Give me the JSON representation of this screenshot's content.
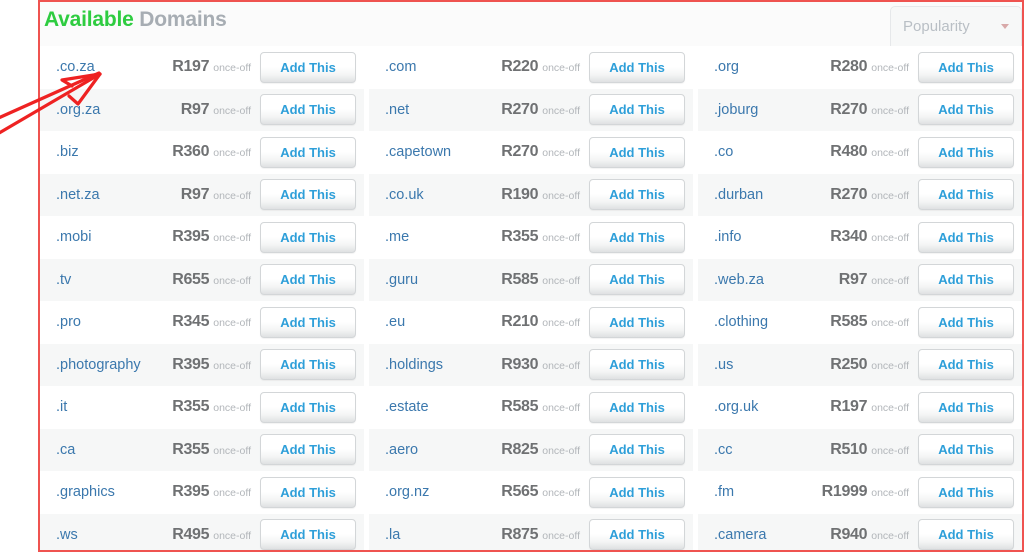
{
  "panel": {
    "title_accent": "Available",
    "title_rest": " Domains",
    "accent_color": "#2ecc40",
    "title_rest_color": "#a7adb3",
    "highlight_border_color": "#ef5350"
  },
  "sort": {
    "label": "Popularity",
    "caret_icon": "chevron-down-icon"
  },
  "annotation": {
    "type": "arrow",
    "color": "#ee2222",
    "points_to": ".co.za"
  },
  "row_defaults": {
    "period": "once-off",
    "add_label": "Add This"
  },
  "columns": [
    {
      "name": "column-1",
      "rows": [
        {
          "tld": ".co.za",
          "price": "R197",
          "period": "once-off",
          "add_label": "Add This"
        },
        {
          "tld": ".org.za",
          "price": "R97",
          "period": "once-off",
          "add_label": "Add This"
        },
        {
          "tld": ".biz",
          "price": "R360",
          "period": "once-off",
          "add_label": "Add This"
        },
        {
          "tld": ".net.za",
          "price": "R97",
          "period": "once-off",
          "add_label": "Add This"
        },
        {
          "tld": ".mobi",
          "price": "R395",
          "period": "once-off",
          "add_label": "Add This"
        },
        {
          "tld": ".tv",
          "price": "R655",
          "period": "once-off",
          "add_label": "Add This"
        },
        {
          "tld": ".pro",
          "price": "R345",
          "period": "once-off",
          "add_label": "Add This"
        },
        {
          "tld": ".photography",
          "price": "R395",
          "period": "once-off",
          "add_label": "Add This"
        },
        {
          "tld": ".it",
          "price": "R355",
          "period": "once-off",
          "add_label": "Add This"
        },
        {
          "tld": ".ca",
          "price": "R355",
          "period": "once-off",
          "add_label": "Add This"
        },
        {
          "tld": ".graphics",
          "price": "R395",
          "period": "once-off",
          "add_label": "Add This"
        },
        {
          "tld": ".ws",
          "price": "R495",
          "period": "once-off",
          "add_label": "Add This"
        }
      ]
    },
    {
      "name": "column-2",
      "rows": [
        {
          "tld": ".com",
          "price": "R220",
          "period": "once-off",
          "add_label": "Add This"
        },
        {
          "tld": ".net",
          "price": "R270",
          "period": "once-off",
          "add_label": "Add This"
        },
        {
          "tld": ".capetown",
          "price": "R270",
          "period": "once-off",
          "add_label": "Add This"
        },
        {
          "tld": ".co.uk",
          "price": "R190",
          "period": "once-off",
          "add_label": "Add This"
        },
        {
          "tld": ".me",
          "price": "R355",
          "period": "once-off",
          "add_label": "Add This"
        },
        {
          "tld": ".guru",
          "price": "R585",
          "period": "once-off",
          "add_label": "Add This"
        },
        {
          "tld": ".eu",
          "price": "R210",
          "period": "once-off",
          "add_label": "Add This"
        },
        {
          "tld": ".holdings",
          "price": "R930",
          "period": "once-off",
          "add_label": "Add This"
        },
        {
          "tld": ".estate",
          "price": "R585",
          "period": "once-off",
          "add_label": "Add This"
        },
        {
          "tld": ".aero",
          "price": "R825",
          "period": "once-off",
          "add_label": "Add This"
        },
        {
          "tld": ".org.nz",
          "price": "R565",
          "period": "once-off",
          "add_label": "Add This"
        },
        {
          "tld": ".la",
          "price": "R875",
          "period": "once-off",
          "add_label": "Add This"
        }
      ]
    },
    {
      "name": "column-3",
      "rows": [
        {
          "tld": ".org",
          "price": "R280",
          "period": "once-off",
          "add_label": "Add This"
        },
        {
          "tld": ".joburg",
          "price": "R270",
          "period": "once-off",
          "add_label": "Add This"
        },
        {
          "tld": ".co",
          "price": "R480",
          "period": "once-off",
          "add_label": "Add This"
        },
        {
          "tld": ".durban",
          "price": "R270",
          "period": "once-off",
          "add_label": "Add This"
        },
        {
          "tld": ".info",
          "price": "R340",
          "period": "once-off",
          "add_label": "Add This"
        },
        {
          "tld": ".web.za",
          "price": "R97",
          "period": "once-off",
          "add_label": "Add This"
        },
        {
          "tld": ".clothing",
          "price": "R585",
          "period": "once-off",
          "add_label": "Add This"
        },
        {
          "tld": ".us",
          "price": "R250",
          "period": "once-off",
          "add_label": "Add This"
        },
        {
          "tld": ".org.uk",
          "price": "R197",
          "period": "once-off",
          "add_label": "Add This"
        },
        {
          "tld": ".cc",
          "price": "R510",
          "period": "once-off",
          "add_label": "Add This"
        },
        {
          "tld": ".fm",
          "price": "R1999",
          "period": "once-off",
          "add_label": "Add This"
        },
        {
          "tld": ".camera",
          "price": "R940",
          "period": "once-off",
          "add_label": "Add This"
        }
      ]
    }
  ]
}
